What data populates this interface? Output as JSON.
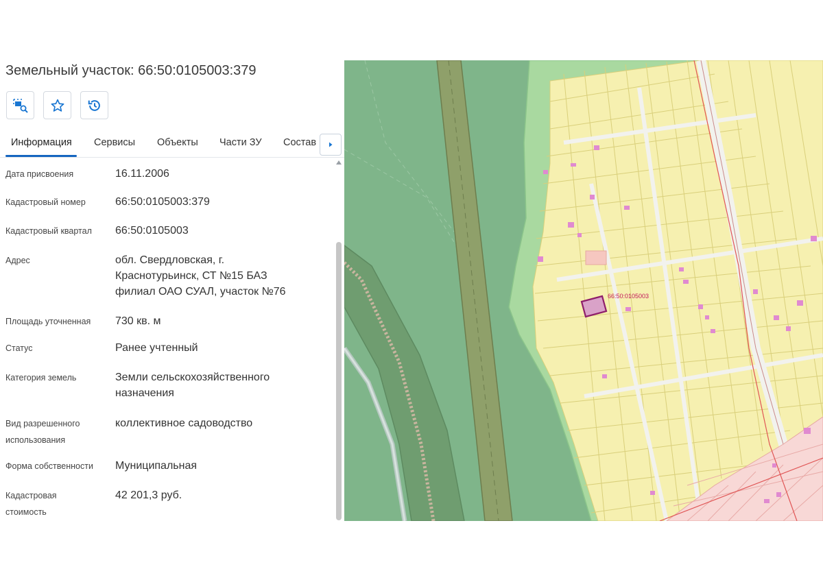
{
  "panel": {
    "title": "Земельный участок: 66:50:0105003:379",
    "tabs": [
      {
        "label": "Информация"
      },
      {
        "label": "Сервисы"
      },
      {
        "label": "Объекты"
      },
      {
        "label": "Части ЗУ"
      },
      {
        "label": "Состав"
      }
    ],
    "info": [
      {
        "label": "Дата присвоения",
        "value": "16.11.2006"
      },
      {
        "label": "Кадастровый номер",
        "value": "66:50:0105003:379"
      },
      {
        "label": "Кадастровый квартал",
        "value": "66:50:0105003"
      },
      {
        "label": "Адрес",
        "value": "обл. Свердловская, г. Краснотурьинск, СТ №15 БАЗ филиал ОАО СУАЛ, участок №76"
      },
      {
        "label": "Площадь уточненная",
        "value": "730 кв. м"
      },
      {
        "label": "Статус",
        "value": "Ранее учтенный"
      },
      {
        "label": "Категория земель",
        "value": "Земли сельскохозяйственного назначения"
      },
      {
        "label": "Вид разрешенного использования",
        "value": "коллективное садоводство"
      },
      {
        "label": "Форма собственности",
        "value": "Муниципальная"
      },
      {
        "label": "Кадастровая стоимость",
        "value": "42 201,3 руб."
      }
    ]
  },
  "map": {
    "parcel_label": "66:50:0105003",
    "colors": {
      "forest": "#7fb58a",
      "green_band": "#a9d9a0",
      "parcel_fill": "#f6f0b0",
      "parcel_stroke": "#d9cf7a",
      "road": "#f2f2ee",
      "railway": "#8fa06a",
      "highlight": "#8e1e6a",
      "building": "#e08ad0",
      "red_zone": "#f8d8d6",
      "red_line": "#e05555"
    }
  },
  "icons": {
    "search_map": "map-search-icon",
    "favorite": "star-icon",
    "history": "history-icon",
    "tab_scroll": "chevron-right-icon"
  }
}
